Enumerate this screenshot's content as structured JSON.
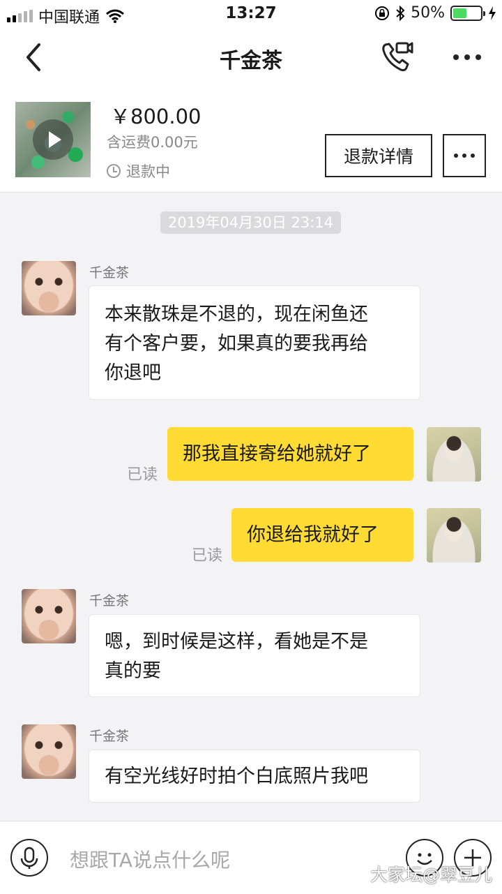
{
  "status_bar": {
    "carrier": "中国联通",
    "time": "13:27",
    "battery": "50%",
    "battery_level": 0.5
  },
  "nav": {
    "title": "千金茶",
    "icons": [
      "back-icon",
      "video-call-icon",
      "more-icon"
    ]
  },
  "product": {
    "price": "￥800.00",
    "shipping": "含运费0.00元",
    "status": "退款中",
    "refund_button": "退款详情"
  },
  "chat": {
    "timestamp": "2019年04月30日  23:14",
    "messages": [
      {
        "sender": "千金茶",
        "direction": "in",
        "text": "本来散珠是不退的，现在闲鱼还\n有个客户要，如果真的要我再给\n你退吧"
      },
      {
        "direction": "out",
        "text": "那我直接寄给她就好了",
        "status": "已读"
      },
      {
        "direction": "out",
        "text": "你退给我就好了",
        "status": "已读"
      },
      {
        "sender": "千金茶",
        "direction": "in",
        "text": "嗯，到时候是这样，看她是不是\n真的要"
      },
      {
        "sender": "千金茶",
        "direction": "in",
        "text": "有空光线好时拍个白底照片我吧"
      }
    ]
  },
  "input": {
    "placeholder": "想跟TA说点什么呢"
  },
  "watermark": "大家坛@翠豆儿",
  "colors": {
    "outgoing_bubble": "#ffdb33",
    "incoming_bubble": "#ffffff",
    "background": "#f3f3f5",
    "battery": "#4cd964"
  }
}
